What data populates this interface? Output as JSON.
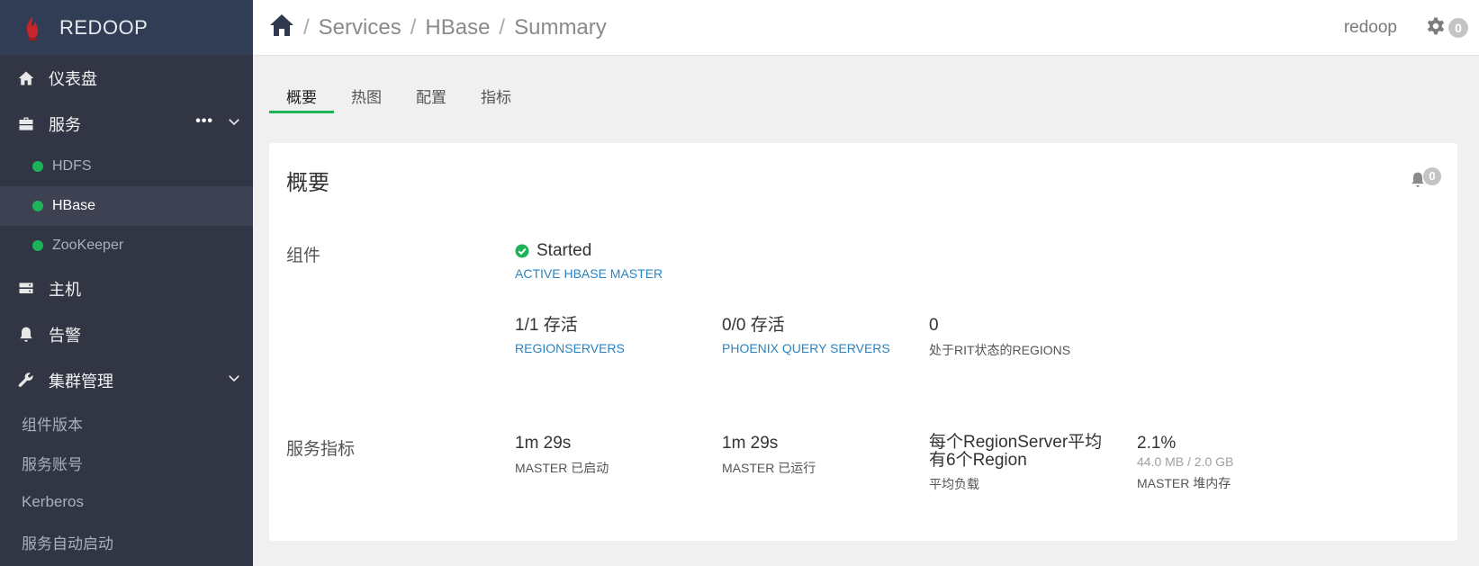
{
  "brand": {
    "name": "REDOOP"
  },
  "sidebar": {
    "items": [
      {
        "label": "仪表盘",
        "icon": "home-icon"
      },
      {
        "label": "服务",
        "icon": "briefcase-icon",
        "more": "•••",
        "expanded": true
      },
      {
        "label": "主机",
        "icon": "server-icon"
      },
      {
        "label": "告警",
        "icon": "bell-icon"
      },
      {
        "label": "集群管理",
        "icon": "wrench-icon",
        "expanded": true
      }
    ],
    "services": [
      {
        "label": "HDFS",
        "status_color": "#1eb35a"
      },
      {
        "label": "HBase",
        "status_color": "#1eb35a",
        "active": true
      },
      {
        "label": "ZooKeeper",
        "status_color": "#1eb35a"
      }
    ],
    "cluster": [
      {
        "label": "组件版本"
      },
      {
        "label": "服务账号"
      },
      {
        "label": "Kerberos"
      },
      {
        "label": "服务自动启动"
      }
    ]
  },
  "header": {
    "breadcrumb": [
      "Services",
      "HBase",
      "Summary"
    ],
    "separator": "/",
    "username": "redoop",
    "notifications": "0"
  },
  "tabs": [
    {
      "label": "概要",
      "active": true
    },
    {
      "label": "热图"
    },
    {
      "label": "配置"
    },
    {
      "label": "指标"
    }
  ],
  "summary": {
    "title": "概要",
    "alerts": "0",
    "components_label": "组件",
    "status": {
      "value": "Started",
      "link": "ACTIVE HBASE MASTER"
    },
    "components": [
      {
        "value": "1/1 存活",
        "link": "REGIONSERVERS"
      },
      {
        "value": "0/0 存活",
        "link": "PHOENIX QUERY SERVERS"
      },
      {
        "value": "0",
        "label": "处于RIT状态的REGIONS"
      }
    ],
    "metrics_label": "服务指标",
    "metrics": [
      {
        "value": "1m 29s",
        "label": "MASTER 已启动"
      },
      {
        "value": "1m 29s",
        "label": "MASTER 已运行"
      },
      {
        "value": "每个RegionServer平均有6个Region",
        "label": "平均负载"
      },
      {
        "value": "2.1%",
        "sub": "44.0 MB / 2.0 GB",
        "label": "MASTER 堆内存"
      }
    ]
  },
  "colors": {
    "sidebar_bg": "#323544",
    "brand_bg": "#313d54",
    "accent_green": "#1eb35a",
    "link_blue": "#2a84c1"
  }
}
